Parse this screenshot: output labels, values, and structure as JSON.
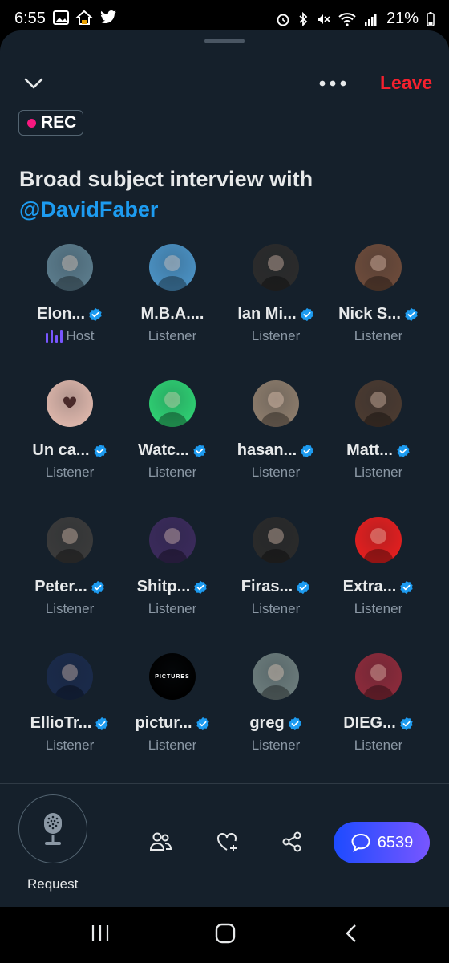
{
  "status_bar": {
    "time": "6:55",
    "battery": "21%"
  },
  "header": {
    "leave_label": "Leave",
    "rec_label": "REC"
  },
  "space": {
    "title": "Broad subject interview with",
    "mention": "@DavidFaber"
  },
  "participants": [
    {
      "name": "Elon...",
      "role": "Host",
      "verified": true,
      "avatar": {
        "bg": "#5a7a8a"
      }
    },
    {
      "name": "M.B.A....",
      "role": "Listener",
      "verified": false,
      "avatar": {
        "bg": "#4a8fc0"
      }
    },
    {
      "name": "Ian Mi...",
      "role": "Listener",
      "verified": true,
      "avatar": {
        "bg": "#2b2b2b"
      }
    },
    {
      "name": "Nick S...",
      "role": "Listener",
      "verified": true,
      "avatar": {
        "bg": "#6b4a3a"
      }
    },
    {
      "name": "Un ca...",
      "role": "Listener",
      "verified": true,
      "avatar": {
        "bg": "#d9b3a8"
      }
    },
    {
      "name": "Watc...",
      "role": "Listener",
      "verified": true,
      "avatar": {
        "bg": "#2ecc71"
      }
    },
    {
      "name": "hasan...",
      "role": "Listener",
      "verified": true,
      "avatar": {
        "bg": "#8a7a6a"
      }
    },
    {
      "name": "Matt...",
      "role": "Listener",
      "verified": true,
      "avatar": {
        "bg": "#4a3a30"
      }
    },
    {
      "name": "Peter...",
      "role": "Listener",
      "verified": true,
      "avatar": {
        "bg": "#3a3a3a"
      }
    },
    {
      "name": "Shitp...",
      "role": "Listener",
      "verified": true,
      "avatar": {
        "bg": "#3a2a5a"
      }
    },
    {
      "name": "Firas...",
      "role": "Listener",
      "verified": true,
      "avatar": {
        "bg": "#2a2a2a"
      }
    },
    {
      "name": "Extra...",
      "role": "Listener",
      "verified": true,
      "avatar": {
        "bg": "#e01f1f"
      }
    },
    {
      "name": "EllioTr...",
      "role": "Listener",
      "verified": true,
      "avatar": {
        "bg": "#1a2a4a"
      }
    },
    {
      "name": "pictur...",
      "role": "Listener",
      "verified": true,
      "avatar": {
        "bg": "#000000",
        "text": "PICTURES"
      }
    },
    {
      "name": "greg",
      "role": "Listener",
      "verified": true,
      "avatar": {
        "bg": "#6a7a7a"
      }
    },
    {
      "name": "DIEG...",
      "role": "Listener",
      "verified": true,
      "avatar": {
        "bg": "#8a2a3a"
      }
    }
  ],
  "bottom": {
    "request_label": "Request",
    "chat_count": "6539"
  },
  "colors": {
    "sheet_bg": "#15202b",
    "accent": "#1d9bf0",
    "leave": "#f4212e",
    "rec_dot": "#f91880",
    "host": "#7856ff"
  },
  "icons": [
    "chevron-down-icon",
    "more-icon",
    "mic-icon",
    "people-icon",
    "heart-plus-icon",
    "share-icon",
    "chat-bubble-icon",
    "verified-icon"
  ]
}
